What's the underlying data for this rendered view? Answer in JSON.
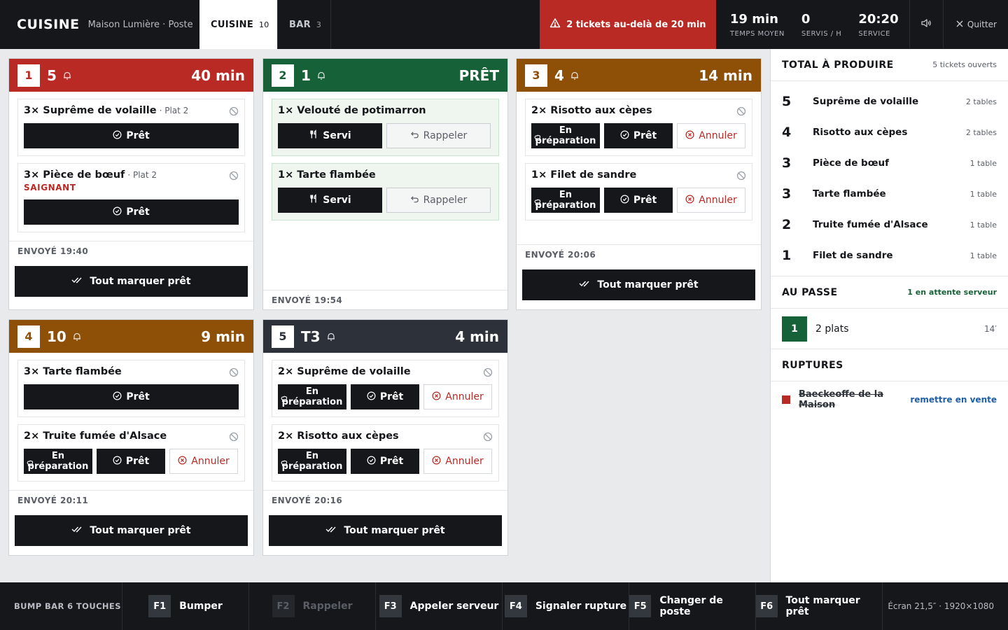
{
  "header": {
    "brand": "CUISINE",
    "subtitle": "Maison Lumière · Poste",
    "tabs": [
      {
        "label": "CUISINE",
        "count": "10"
      },
      {
        "label": "BAR",
        "count": "3"
      }
    ],
    "alert": "2 tickets au-delà de 20 min",
    "metrics": [
      {
        "value": "19 min",
        "label": "TEMPS MOYEN"
      },
      {
        "value": "0",
        "label": "SERVIS / H"
      },
      {
        "value": "20:20",
        "label": "SERVICE"
      }
    ],
    "quit": "Quitter"
  },
  "labels": {
    "ready": "Prêt",
    "served": "Servi",
    "recall": "Rappeler",
    "cancel": "Annuler",
    "prep_line1": "En",
    "prep_line2": "préparation",
    "mark_all": "Tout marquer prêt"
  },
  "tickets": [
    {
      "num": "1",
      "table": "5",
      "time": "40 min",
      "color": "#b92a24",
      "sent": "ENVOYÉ 19:40",
      "items": [
        {
          "name": "3× Suprême de volaille",
          "course": "· Plat 2"
        },
        {
          "name": "3× Pièce de bœuf",
          "course": "· Plat 2",
          "mod": "SAIGNANT"
        }
      ]
    },
    {
      "num": "2",
      "table": "1",
      "time": "PRÊT",
      "color": "#176138",
      "sent": "ENVOYÉ 19:54",
      "items": [
        {
          "name": "1× Velouté de potimarron"
        },
        {
          "name": "1× Tarte flambée"
        }
      ]
    },
    {
      "num": "3",
      "table": "4",
      "time": "14 min",
      "color": "#8d5006",
      "sent": "ENVOYÉ 20:06",
      "items": [
        {
          "name": "2× Risotto aux cèpes"
        },
        {
          "name": "1× Filet de sandre"
        }
      ]
    },
    {
      "num": "4",
      "table": "10",
      "time": "9 min",
      "color": "#8d5006",
      "sent": "ENVOYÉ 20:11",
      "items": [
        {
          "name": "3× Tarte flambée"
        },
        {
          "name": "2× Truite fumée d'Alsace"
        }
      ]
    },
    {
      "num": "5",
      "table": "T3",
      "time": "4 min",
      "color": "#2d323a",
      "sent": "ENVOYÉ 20:16",
      "items": [
        {
          "name": "2× Suprême de volaille"
        },
        {
          "name": "2× Risotto aux cèpes"
        }
      ]
    }
  ],
  "panel": {
    "totals_title": "TOTAL À PRODUIRE",
    "totals_sub": "5 tickets ouverts",
    "totals": [
      {
        "qty": "5",
        "name": "Suprême de volaille",
        "count": "2 tables"
      },
      {
        "qty": "4",
        "name": "Risotto aux cèpes",
        "count": "2 tables"
      },
      {
        "qty": "3",
        "name": "Pièce de bœuf",
        "count": "1 table"
      },
      {
        "qty": "3",
        "name": "Tarte flambée",
        "count": "1 table"
      },
      {
        "qty": "2",
        "name": "Truite fumée d'Alsace",
        "count": "1 table"
      },
      {
        "qty": "1",
        "name": "Filet de sandre",
        "count": "1 table"
      }
    ],
    "passe_title": "AU PASSE",
    "passe_sub": "1 en attente serveur",
    "passe": {
      "num": "1",
      "label": "2 plats",
      "age": "14′"
    },
    "ruptures_title": "RUPTURES",
    "rupture": {
      "name": "Baeckeoffe de la Maison",
      "action": "remettre en vente"
    }
  },
  "footer": {
    "label": "BUMP BAR 6 TOUCHES",
    "keys": [
      {
        "key": "F1",
        "label": "Bumper"
      },
      {
        "key": "F2",
        "label": "Rappeler"
      },
      {
        "key": "F3",
        "label": "Appeler serveur"
      },
      {
        "key": "F4",
        "label": "Signaler rupture"
      },
      {
        "key": "F5",
        "label": "Changer de poste"
      },
      {
        "key": "F6",
        "label": "Tout marquer prêt"
      }
    ],
    "info": "Écran 21,5″ · 1920×1080"
  }
}
